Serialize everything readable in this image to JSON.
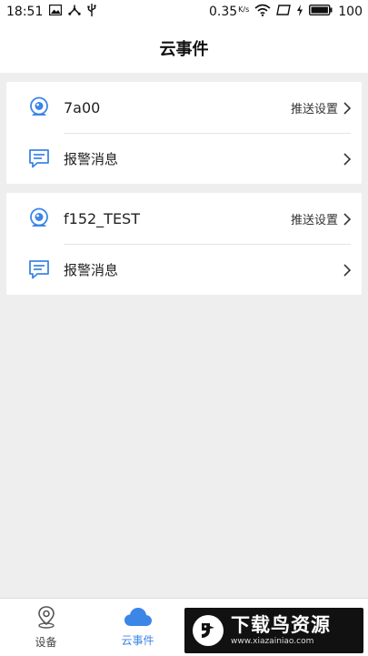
{
  "status_bar": {
    "time": "18:51",
    "speed_value": "0.35",
    "speed_unit": "K/s",
    "battery": "100"
  },
  "header": {
    "title": "云事件"
  },
  "devices": [
    {
      "name": "7a00",
      "push_settings": "推送设置",
      "alarm_label": "报警消息"
    },
    {
      "name": "f152_TEST",
      "push_settings": "推送设置",
      "alarm_label": "报警消息"
    }
  ],
  "tabs": [
    {
      "label": "设备",
      "icon": "map-pin-icon"
    },
    {
      "label": "云事件",
      "icon": "cloud-icon",
      "active": true
    }
  ],
  "watermark": {
    "title": "下载鸟资源",
    "url": "www.xiazainiao.com"
  },
  "colors": {
    "accent": "#3b86e6",
    "background": "#eeeeee",
    "watermark_bg": "#111111"
  }
}
